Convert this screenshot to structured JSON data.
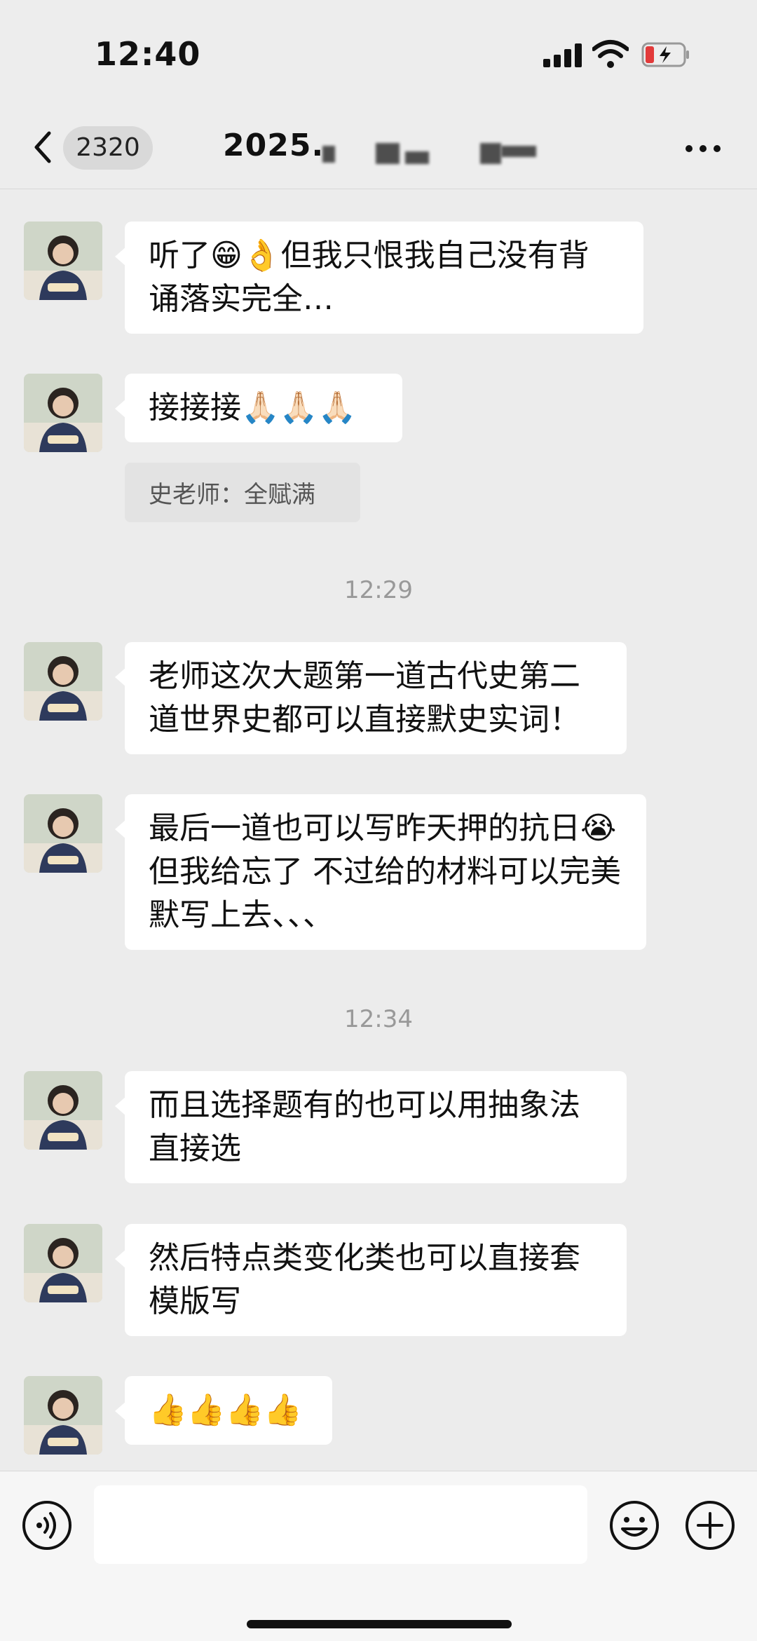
{
  "status_bar": {
    "time": "12:40"
  },
  "header": {
    "back_icon": "chevron-left-icon",
    "unread_count": "2320",
    "title": "2025.",
    "more_icon": "more-dots-icon"
  },
  "messages": [
    {
      "type": "text",
      "text": "听了😁👌但我只恨我自己没有背诵落实完全…"
    },
    {
      "type": "text",
      "text": "接接接🙏🏻🙏🏻🙏🏻",
      "quote": "史老师：全赋满"
    },
    {
      "type": "time",
      "text": "12:29"
    },
    {
      "type": "text",
      "text": "老师这次大题第一道古代史第二道世界史都可以直接默史实词！"
    },
    {
      "type": "text",
      "text": "最后一道也可以写昨天押的抗日😭但我给忘了 不过给的材料可以完美默写上去、、、"
    },
    {
      "type": "time",
      "text": "12:34"
    },
    {
      "type": "text",
      "text": "而且选择题有的也可以用抽象法直接选"
    },
    {
      "type": "text",
      "text": "然后特点类变化类也可以直接套模版写"
    },
    {
      "type": "text",
      "text": "👍👍👍👍"
    }
  ],
  "input_bar": {
    "voice_icon": "voice-icon",
    "emoji_icon": "emoji-icon",
    "plus_icon": "plus-icon"
  },
  "colors": {
    "bubble": "#ffffff",
    "background": "#ececec",
    "quote": "#e3e3e3"
  }
}
